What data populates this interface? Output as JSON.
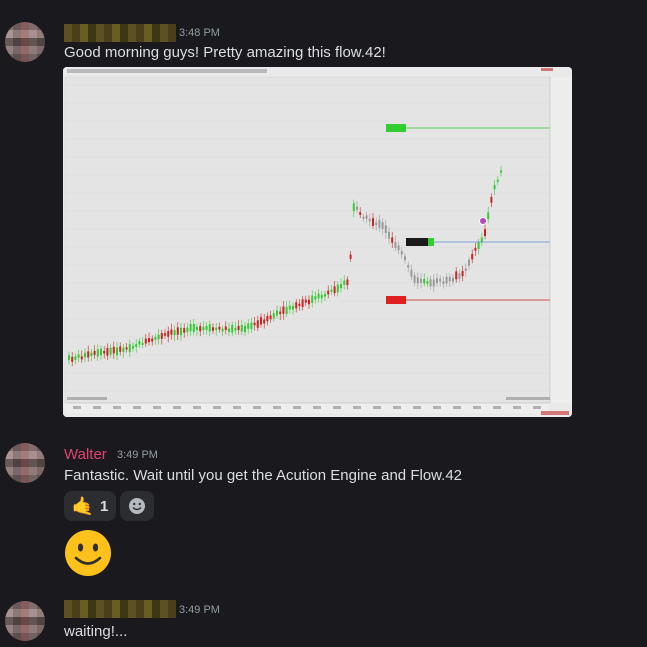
{
  "messages": [
    {
      "time": "3:48 PM",
      "text": "Good morning guys! Pretty amazing this flow.42!"
    },
    {
      "username": "Walter",
      "time": "3:49 PM",
      "text": "Fantastic. Wait until you get the Acution Engine and Flow.42"
    },
    {
      "time": "3:49 PM",
      "text": "waiting!..."
    }
  ],
  "reactions": [
    {
      "icon": "call-me-hand-icon",
      "count": "1"
    },
    {
      "icon": "add-reaction-icon"
    }
  ],
  "colors": {
    "background": "#1a1a1e",
    "username": "#e0446e",
    "up_candle": "#33cc33",
    "down_candle": "#cc2222",
    "neutral_candle": "#9a9a9a"
  }
}
